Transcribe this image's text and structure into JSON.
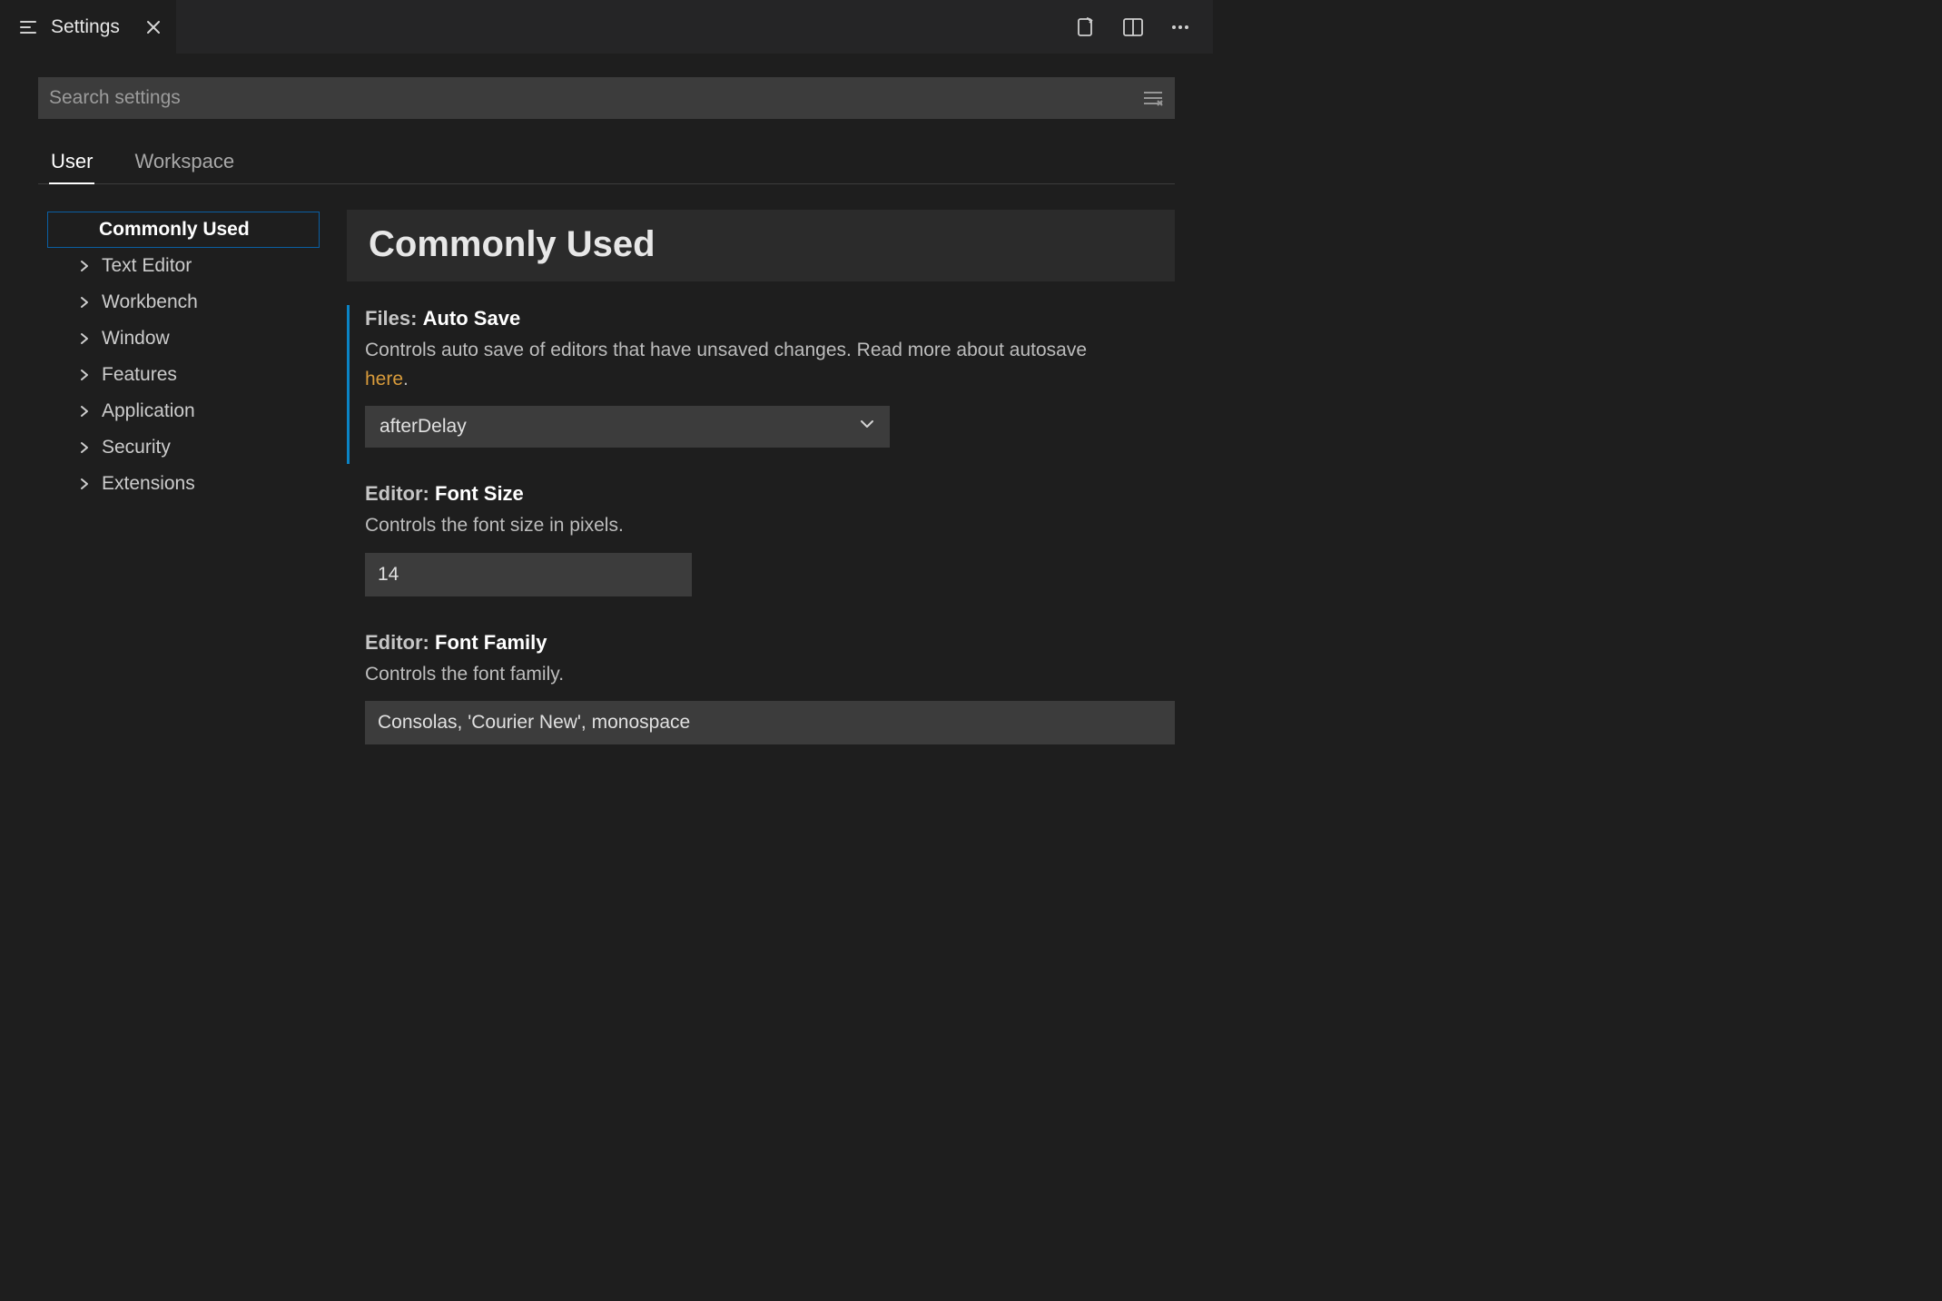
{
  "tab": {
    "title": "Settings"
  },
  "search": {
    "placeholder": "Search settings"
  },
  "scopeTabs": {
    "user": "User",
    "workspace": "Workspace"
  },
  "toc": {
    "items": [
      "Commonly Used",
      "Text Editor",
      "Workbench",
      "Window",
      "Features",
      "Application",
      "Security",
      "Extensions"
    ]
  },
  "groupHeader": "Commonly Used",
  "settings": {
    "autoSave": {
      "category": "Files:",
      "name": "Auto Save",
      "descriptionPre": "Controls auto save of editors that have unsaved changes. Read more about autosave ",
      "link": "here",
      "descriptionPost": ".",
      "value": "afterDelay"
    },
    "fontSize": {
      "category": "Editor:",
      "name": "Font Size",
      "description": "Controls the font size in pixels.",
      "value": "14"
    },
    "fontFamily": {
      "category": "Editor:",
      "name": "Font Family",
      "description": "Controls the font family.",
      "value": "Consolas, 'Courier New', monospace"
    }
  }
}
